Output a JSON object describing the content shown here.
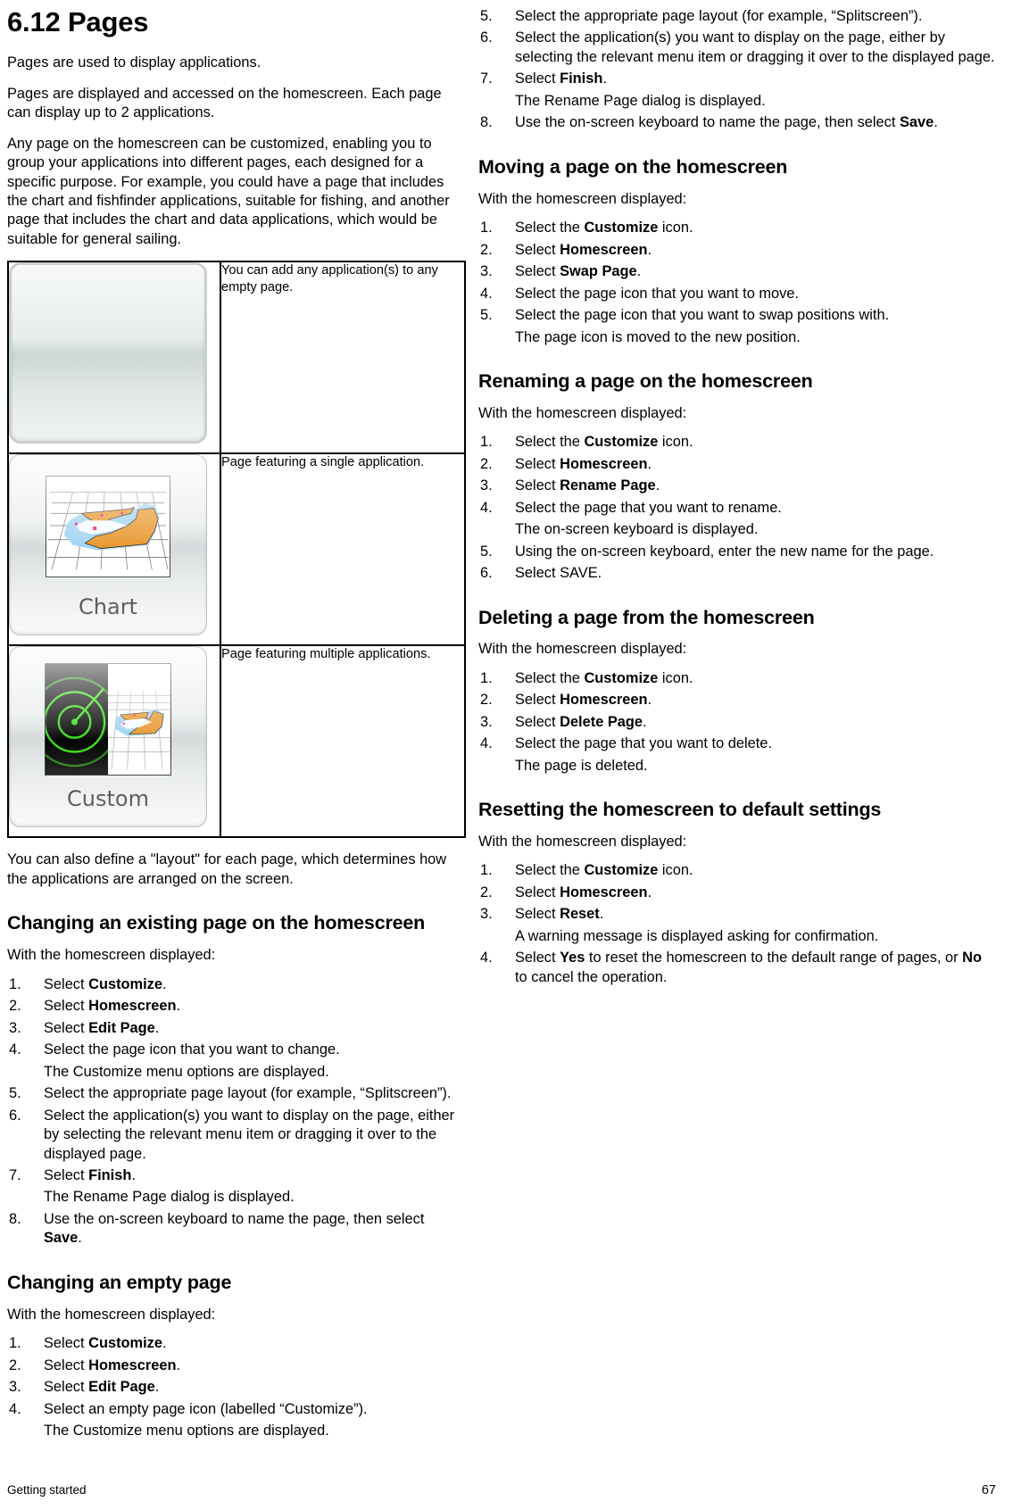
{
  "document": {
    "chapter_title": "6.12 Pages",
    "footer_left": "Getting started",
    "footer_page": "67"
  },
  "intro": {
    "p1": "Pages are used to display applications.",
    "p2": "Pages are displayed and accessed on the homescreen. Each page can display up to 2 applications.",
    "p3": "Any page on the homescreen can be customized, enabling you to group your applications into different pages, each designed for a specific purpose. For example, you could have a page that includes the chart and fishfinder applications, suitable for fishing, and another page that includes the chart and data applications, which would be suitable for general sailing.",
    "p4": "You can also define a \"layout\" for each page, which determines how the applications are arranged on the screen."
  },
  "figure_table": {
    "rows": [
      {
        "icon_name": "empty-page-icon",
        "icon_label": "",
        "caption": "You can add any application(s) to any empty page."
      },
      {
        "icon_name": "chart-page-icon",
        "icon_label": "Chart",
        "caption": "Page featuring a single application."
      },
      {
        "icon_name": "custom-page-icon",
        "icon_label": "Custom",
        "caption": "Page featuring multiple applications."
      }
    ]
  },
  "sections": [
    {
      "id": "changing-existing-page",
      "heading": "Changing an existing page on the homescreen",
      "intro": "With the homescreen displayed:",
      "items": [
        {
          "kind": "step",
          "num": "1.",
          "parts": [
            {
              "t": "Select "
            },
            {
              "t": "Customize",
              "b": true
            },
            {
              "t": "."
            }
          ]
        },
        {
          "kind": "step",
          "num": "2.",
          "parts": [
            {
              "t": "Select "
            },
            {
              "t": "Homescreen",
              "b": true
            },
            {
              "t": "."
            }
          ]
        },
        {
          "kind": "step",
          "num": "3.",
          "parts": [
            {
              "t": "Select "
            },
            {
              "t": "Edit Page",
              "b": true
            },
            {
              "t": "."
            }
          ]
        },
        {
          "kind": "step",
          "num": "4.",
          "parts": [
            {
              "t": "Select the page icon that you want to change."
            }
          ]
        },
        {
          "kind": "result",
          "parts": [
            {
              "t": "The Customize menu options are displayed."
            }
          ]
        },
        {
          "kind": "step",
          "num": "5.",
          "parts": [
            {
              "t": "Select the appropriate page layout (for example, “Splitscreen”)."
            }
          ]
        },
        {
          "kind": "step",
          "num": "6.",
          "parts": [
            {
              "t": "Select the application(s) you want to display on the page, either by selecting the relevant menu item or dragging it over to the displayed page."
            }
          ]
        },
        {
          "kind": "step",
          "num": "7.",
          "parts": [
            {
              "t": "Select "
            },
            {
              "t": "Finish",
              "b": true
            },
            {
              "t": "."
            }
          ]
        },
        {
          "kind": "result",
          "parts": [
            {
              "t": "The Rename Page dialog is displayed."
            }
          ]
        },
        {
          "kind": "step",
          "num": "8.",
          "parts": [
            {
              "t": "Use the on-screen keyboard to name the page, then select "
            },
            {
              "t": "Save",
              "b": true
            },
            {
              "t": "."
            }
          ]
        }
      ]
    },
    {
      "id": "changing-empty-page",
      "heading": "Changing an empty page",
      "intro": "With the homescreen displayed:",
      "items": [
        {
          "kind": "step",
          "num": "1.",
          "parts": [
            {
              "t": "Select "
            },
            {
              "t": "Customize",
              "b": true
            },
            {
              "t": "."
            }
          ]
        },
        {
          "kind": "step",
          "num": "2.",
          "parts": [
            {
              "t": "Select "
            },
            {
              "t": "Homescreen",
              "b": true
            },
            {
              "t": "."
            }
          ]
        },
        {
          "kind": "step",
          "num": "3.",
          "parts": [
            {
              "t": "Select "
            },
            {
              "t": "Edit Page",
              "b": true
            },
            {
              "t": "."
            }
          ]
        },
        {
          "kind": "step",
          "num": "4.",
          "parts": [
            {
              "t": "Select an empty page icon (labelled “Customize”)."
            }
          ]
        },
        {
          "kind": "result",
          "parts": [
            {
              "t": "The Customize menu options are displayed."
            }
          ]
        }
      ]
    },
    {
      "id": "changing-empty-page-cont",
      "heading": "",
      "intro": "",
      "items": [
        {
          "kind": "step",
          "num": "5.",
          "parts": [
            {
              "t": "Select the appropriate page layout (for example, “Splitscreen”)."
            }
          ]
        },
        {
          "kind": "step",
          "num": "6.",
          "parts": [
            {
              "t": "Select the application(s) you want to display on the page, either by selecting the relevant menu item or dragging it over to the displayed page."
            }
          ]
        },
        {
          "kind": "step",
          "num": "7.",
          "parts": [
            {
              "t": "Select "
            },
            {
              "t": "Finish",
              "b": true
            },
            {
              "t": "."
            }
          ]
        },
        {
          "kind": "result",
          "parts": [
            {
              "t": "The Rename Page dialog is displayed."
            }
          ]
        },
        {
          "kind": "step",
          "num": "8.",
          "parts": [
            {
              "t": "Use the on-screen keyboard to name the page, then select "
            },
            {
              "t": "Save",
              "b": true
            },
            {
              "t": "."
            }
          ]
        }
      ]
    },
    {
      "id": "moving-page",
      "heading": "Moving a page on the homescreen",
      "intro": "With the homescreen displayed:",
      "items": [
        {
          "kind": "step",
          "num": "1.",
          "parts": [
            {
              "t": "Select the "
            },
            {
              "t": "Customize",
              "b": true
            },
            {
              "t": " icon."
            }
          ]
        },
        {
          "kind": "step",
          "num": "2.",
          "parts": [
            {
              "t": "Select "
            },
            {
              "t": "Homescreen",
              "b": true
            },
            {
              "t": "."
            }
          ]
        },
        {
          "kind": "step",
          "num": "3.",
          "parts": [
            {
              "t": "Select "
            },
            {
              "t": "Swap Page",
              "b": true
            },
            {
              "t": "."
            }
          ]
        },
        {
          "kind": "step",
          "num": "4.",
          "parts": [
            {
              "t": "Select the page icon that you want to move."
            }
          ]
        },
        {
          "kind": "step",
          "num": "5.",
          "parts": [
            {
              "t": "Select the page icon that you want to swap positions with."
            }
          ]
        },
        {
          "kind": "result",
          "parts": [
            {
              "t": "The page icon is moved to the new position."
            }
          ]
        }
      ]
    },
    {
      "id": "renaming-page",
      "heading": "Renaming a page on the homescreen",
      "intro": "With the homescreen displayed:",
      "items": [
        {
          "kind": "step",
          "num": "1.",
          "parts": [
            {
              "t": "Select the "
            },
            {
              "t": "Customize",
              "b": true
            },
            {
              "t": " icon."
            }
          ]
        },
        {
          "kind": "step",
          "num": "2.",
          "parts": [
            {
              "t": "Select "
            },
            {
              "t": "Homescreen",
              "b": true
            },
            {
              "t": "."
            }
          ]
        },
        {
          "kind": "step",
          "num": "3.",
          "parts": [
            {
              "t": "Select "
            },
            {
              "t": "Rename Page",
              "b": true
            },
            {
              "t": "."
            }
          ]
        },
        {
          "kind": "step",
          "num": "4.",
          "parts": [
            {
              "t": "Select the page that you want to rename."
            }
          ]
        },
        {
          "kind": "result",
          "parts": [
            {
              "t": "The on-screen keyboard is displayed."
            }
          ]
        },
        {
          "kind": "step",
          "num": "5.",
          "parts": [
            {
              "t": "Using the on-screen keyboard, enter the new name for the page."
            }
          ]
        },
        {
          "kind": "step",
          "num": "6.",
          "parts": [
            {
              "t": "Select SAVE."
            }
          ]
        }
      ]
    },
    {
      "id": "deleting-page",
      "heading": "Deleting a page from the homescreen",
      "intro": "With the homescreen displayed:",
      "items": [
        {
          "kind": "step",
          "num": "1.",
          "parts": [
            {
              "t": "Select the "
            },
            {
              "t": "Customize",
              "b": true
            },
            {
              "t": " icon."
            }
          ]
        },
        {
          "kind": "step",
          "num": "2.",
          "parts": [
            {
              "t": "Select "
            },
            {
              "t": "Homescreen",
              "b": true
            },
            {
              "t": "."
            }
          ]
        },
        {
          "kind": "step",
          "num": "3.",
          "parts": [
            {
              "t": "Select "
            },
            {
              "t": "Delete Page",
              "b": true
            },
            {
              "t": "."
            }
          ]
        },
        {
          "kind": "step",
          "num": "4.",
          "parts": [
            {
              "t": "Select the page that you want to delete."
            }
          ]
        },
        {
          "kind": "result",
          "parts": [
            {
              "t": "The page is deleted."
            }
          ]
        }
      ]
    },
    {
      "id": "resetting-homescreen",
      "heading": "Resetting the homescreen to default settings",
      "intro": "With the homescreen displayed:",
      "items": [
        {
          "kind": "step",
          "num": "1.",
          "parts": [
            {
              "t": "Select the "
            },
            {
              "t": "Customize",
              "b": true
            },
            {
              "t": " icon."
            }
          ]
        },
        {
          "kind": "step",
          "num": "2.",
          "parts": [
            {
              "t": "Select "
            },
            {
              "t": "Homescreen",
              "b": true
            },
            {
              "t": "."
            }
          ]
        },
        {
          "kind": "step",
          "num": "3.",
          "parts": [
            {
              "t": "Select "
            },
            {
              "t": "Reset",
              "b": true
            },
            {
              "t": "."
            }
          ]
        },
        {
          "kind": "result",
          "parts": [
            {
              "t": "A warning message is displayed asking for confirmation."
            }
          ]
        },
        {
          "kind": "step",
          "num": "4.",
          "parts": [
            {
              "t": "Select "
            },
            {
              "t": "Yes",
              "b": true
            },
            {
              "t": " to reset the homescreen to the default range of pages, or "
            },
            {
              "t": "No",
              "b": true
            },
            {
              "t": " to cancel the operation."
            }
          ]
        }
      ]
    }
  ],
  "colors": {
    "land": "#e8962a",
    "shallow": "#9fd3f0",
    "radar_green": "#35e015",
    "waypoint": "#e8176b"
  }
}
